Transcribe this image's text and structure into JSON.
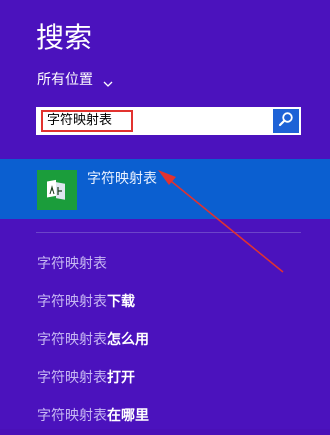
{
  "header": {
    "title": "搜索"
  },
  "scope": {
    "label": "所有位置",
    "icon": "chevron-down-icon"
  },
  "search": {
    "value": "字符映射表",
    "button_icon": "search-icon"
  },
  "results": [
    {
      "label": "字符映射表",
      "icon": "character-map-app-icon"
    }
  ],
  "suggestions": [
    {
      "query": "字符映射表",
      "rest": ""
    },
    {
      "query": "字符映射表",
      "rest": "下载"
    },
    {
      "query": "字符映射表",
      "rest": "怎么用"
    },
    {
      "query": "字符映射表",
      "rest": "打开"
    },
    {
      "query": "字符映射表",
      "rest": "在哪里"
    }
  ],
  "colors": {
    "background": "#4b12bd",
    "highlight": "#0b5fd0",
    "search_button": "#1e62d6",
    "annotation_red": "#e2322f",
    "app_tile": "#1b9d3b"
  }
}
